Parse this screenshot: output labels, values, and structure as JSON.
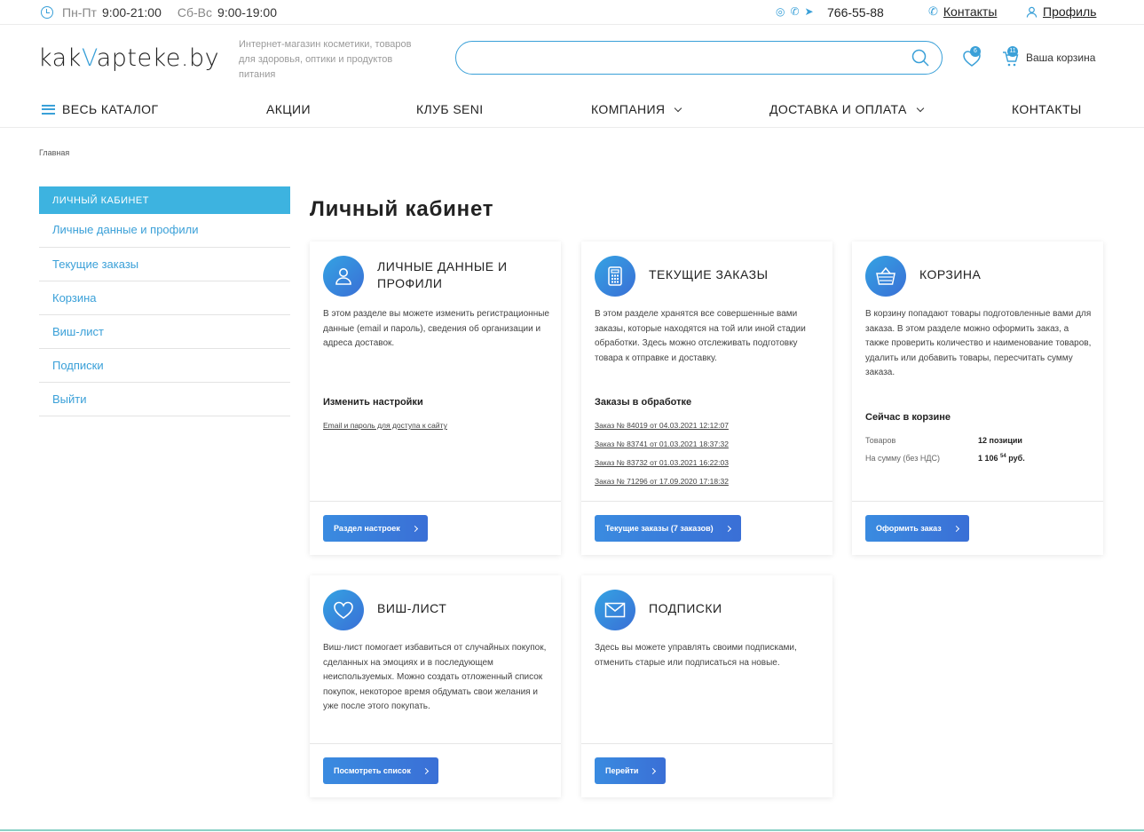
{
  "topbar": {
    "weekdays_label": "Пн-Пт",
    "weekdays_hours": "9:00-21:00",
    "weekend_label": "Сб-Вс",
    "weekend_hours": "9:00-19:00",
    "phone": "766-55-88",
    "contacts": "Контакты",
    "profile": "Профиль"
  },
  "header": {
    "logo_pre": "kak",
    "logo_v": "V",
    "logo_post": "apteke.by",
    "tagline": "Интернет-магазин косметики, товаров для здоровья, оптики и продуктов питания",
    "search_placeholder": "",
    "fav_count": "6",
    "cart_count": "11",
    "cart_label": "Ваша корзина"
  },
  "nav": {
    "catalog": "ВЕСЬ КАТАЛОГ",
    "promo": "АКЦИИ",
    "club": "КЛУБ SENI",
    "company": "КОМПАНИЯ",
    "delivery": "ДОСТАВКА И ОПЛАТА",
    "contacts": "КОНТАКТЫ"
  },
  "breadcrumb": "Главная",
  "sidebar": {
    "head": "ЛИЧНЫЙ КАБИНЕТ",
    "items": [
      "Личные данные и профили",
      "Текущие заказы",
      "Корзина",
      "Виш-лист",
      "Подписки",
      "Выйти"
    ]
  },
  "page_title": "Личный кабинет",
  "cards": {
    "profile": {
      "title": "ЛИЧНЫЕ ДАННЫЕ И ПРОФИЛИ",
      "desc": "В этом разделе вы можете изменить регистрационные данные (email и пароль), сведения об организации и адреса доставок.",
      "sub": "Изменить настройки",
      "link": "Email и пароль для доступа к сайту",
      "button": "Раздел настроек"
    },
    "orders": {
      "title": "ТЕКУЩИЕ ЗАКАЗЫ",
      "desc": "В этом разделе хранятся все совершенные вами заказы, которые находятся на той или иной стадии обработки. Здесь можно отслеживать подготовку товара к отправке и доставку.",
      "sub": "Заказы в обработке",
      "links": [
        "Заказ № 84019 от 04.03.2021 12:12:07",
        "Заказ № 83741 от 01.03.2021 18:37:32",
        "Заказ № 83732 от 01.03.2021 16:22:03",
        "Заказ № 71296 от 17.09.2020 17:18:32"
      ],
      "button": "Текущие заказы (7 заказов)"
    },
    "cart": {
      "title": "КОРЗИНА",
      "desc": "В корзину попадают товары подготовленные вами для заказа. В этом разделе можно оформить заказ, а также проверить количество и наименование товаров, удалить или добавить товары, пересчитать сумму заказа.",
      "sub": "Сейчас в корзине",
      "items_label": "Товаров",
      "items_value": "12 позиции",
      "sum_label": "На сумму (без НДС)",
      "sum_main": "1 106",
      "sum_cents": "54",
      "sum_currency": "руб.",
      "button": "Оформить заказ"
    },
    "wishlist": {
      "title": "ВИШ-ЛИСТ",
      "desc": "Виш-лист помогает избавиться от случайных покупок, сделанных на эмоциях и в последующем неиспользуемых. Можно создать отложенный список покупок, некоторое время обдумать свои желания и уже после этого покупать.",
      "button": "Посмотреть список"
    },
    "subs": {
      "title": "ПОДПИСКИ",
      "desc": "Здесь вы можете управлять своими подписками, отменить старые или подписаться на новые.",
      "button": "Перейти"
    }
  }
}
